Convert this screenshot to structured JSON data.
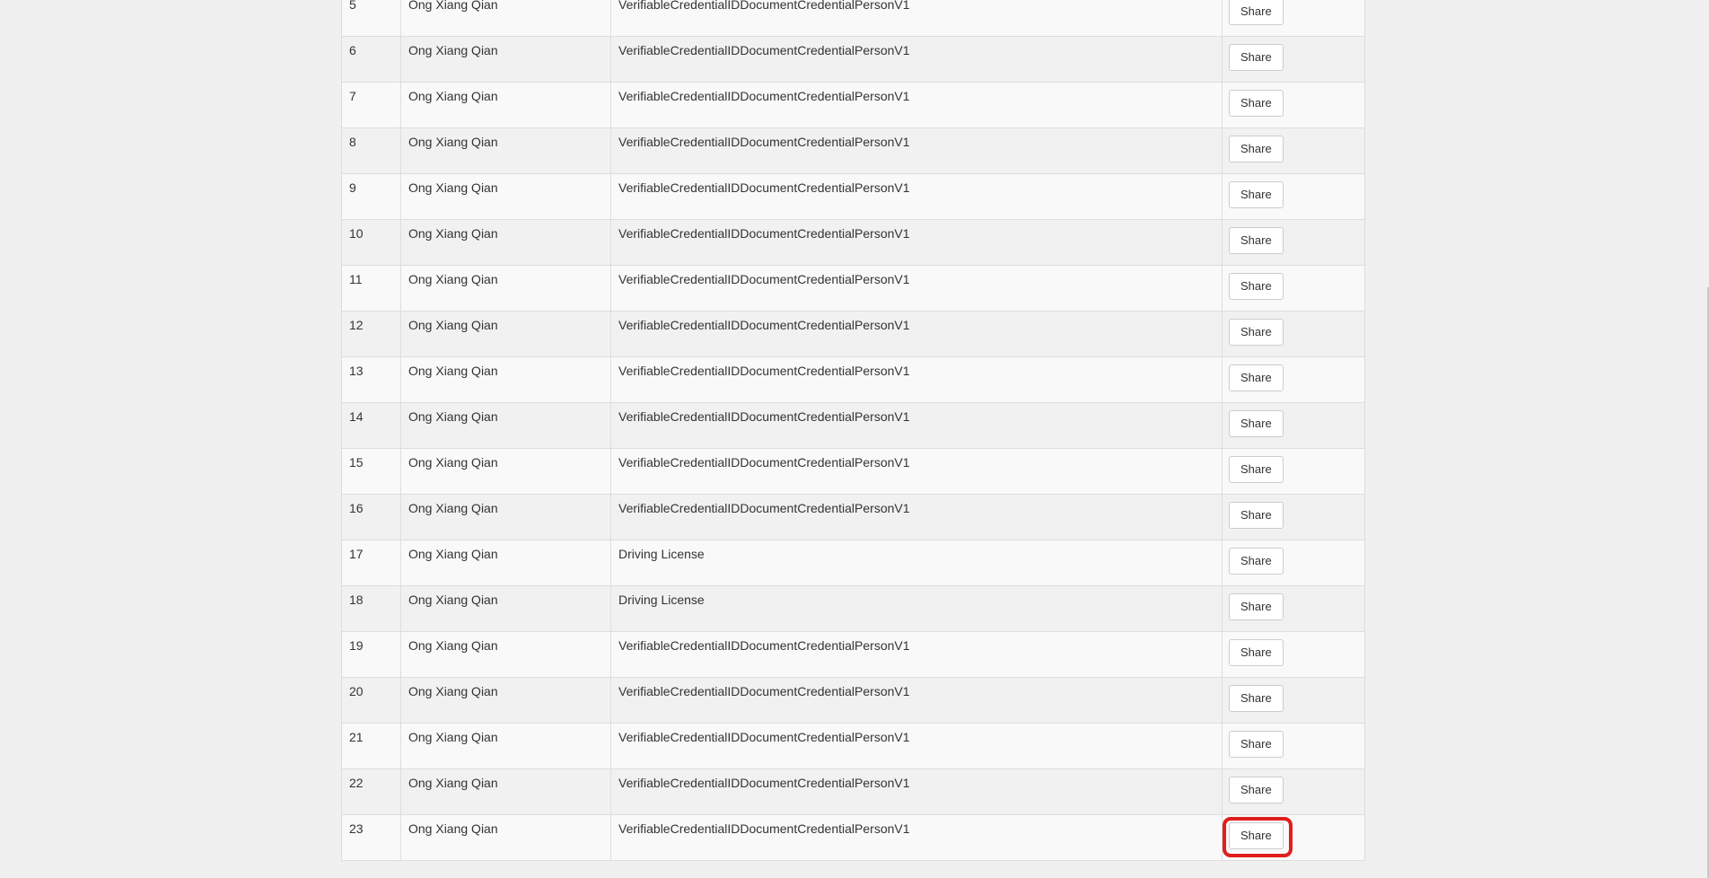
{
  "table": {
    "action_label": "Share",
    "highlighted_row": "23",
    "rows": [
      {
        "num": "5",
        "name": "Ong Xiang Qian",
        "type": "VerifiableCredentialIDDocumentCredentialPersonV1",
        "action": "Share"
      },
      {
        "num": "6",
        "name": "Ong Xiang Qian",
        "type": "VerifiableCredentialIDDocumentCredentialPersonV1",
        "action": "Share"
      },
      {
        "num": "7",
        "name": "Ong Xiang Qian",
        "type": "VerifiableCredentialIDDocumentCredentialPersonV1",
        "action": "Share"
      },
      {
        "num": "8",
        "name": "Ong Xiang Qian",
        "type": "VerifiableCredentialIDDocumentCredentialPersonV1",
        "action": "Share"
      },
      {
        "num": "9",
        "name": "Ong Xiang Qian",
        "type": "VerifiableCredentialIDDocumentCredentialPersonV1",
        "action": "Share"
      },
      {
        "num": "10",
        "name": "Ong Xiang Qian",
        "type": "VerifiableCredentialIDDocumentCredentialPersonV1",
        "action": "Share"
      },
      {
        "num": "11",
        "name": "Ong Xiang Qian",
        "type": "VerifiableCredentialIDDocumentCredentialPersonV1",
        "action": "Share"
      },
      {
        "num": "12",
        "name": "Ong Xiang Qian",
        "type": "VerifiableCredentialIDDocumentCredentialPersonV1",
        "action": "Share"
      },
      {
        "num": "13",
        "name": "Ong Xiang Qian",
        "type": "VerifiableCredentialIDDocumentCredentialPersonV1",
        "action": "Share"
      },
      {
        "num": "14",
        "name": "Ong Xiang Qian",
        "type": "VerifiableCredentialIDDocumentCredentialPersonV1",
        "action": "Share"
      },
      {
        "num": "15",
        "name": "Ong Xiang Qian",
        "type": "VerifiableCredentialIDDocumentCredentialPersonV1",
        "action": "Share"
      },
      {
        "num": "16",
        "name": "Ong Xiang Qian",
        "type": "VerifiableCredentialIDDocumentCredentialPersonV1",
        "action": "Share"
      },
      {
        "num": "17",
        "name": "Ong Xiang Qian",
        "type": "Driving License",
        "action": "Share"
      },
      {
        "num": "18",
        "name": "Ong Xiang Qian",
        "type": "Driving License",
        "action": "Share"
      },
      {
        "num": "19",
        "name": "Ong Xiang Qian",
        "type": "VerifiableCredentialIDDocumentCredentialPersonV1",
        "action": "Share"
      },
      {
        "num": "20",
        "name": "Ong Xiang Qian",
        "type": "VerifiableCredentialIDDocumentCredentialPersonV1",
        "action": "Share"
      },
      {
        "num": "21",
        "name": "Ong Xiang Qian",
        "type": "VerifiableCredentialIDDocumentCredentialPersonV1",
        "action": "Share"
      },
      {
        "num": "22",
        "name": "Ong Xiang Qian",
        "type": "VerifiableCredentialIDDocumentCredentialPersonV1",
        "action": "Share"
      },
      {
        "num": "23",
        "name": "Ong Xiang Qian",
        "type": "VerifiableCredentialIDDocumentCredentialPersonV1",
        "action": "Share"
      }
    ]
  },
  "colors": {
    "page_background": "#f0f0f0",
    "row_light": "#f9f9f9",
    "row_dark": "#f1f1f1",
    "border": "#dddddd",
    "highlight": "#e01e1e"
  }
}
